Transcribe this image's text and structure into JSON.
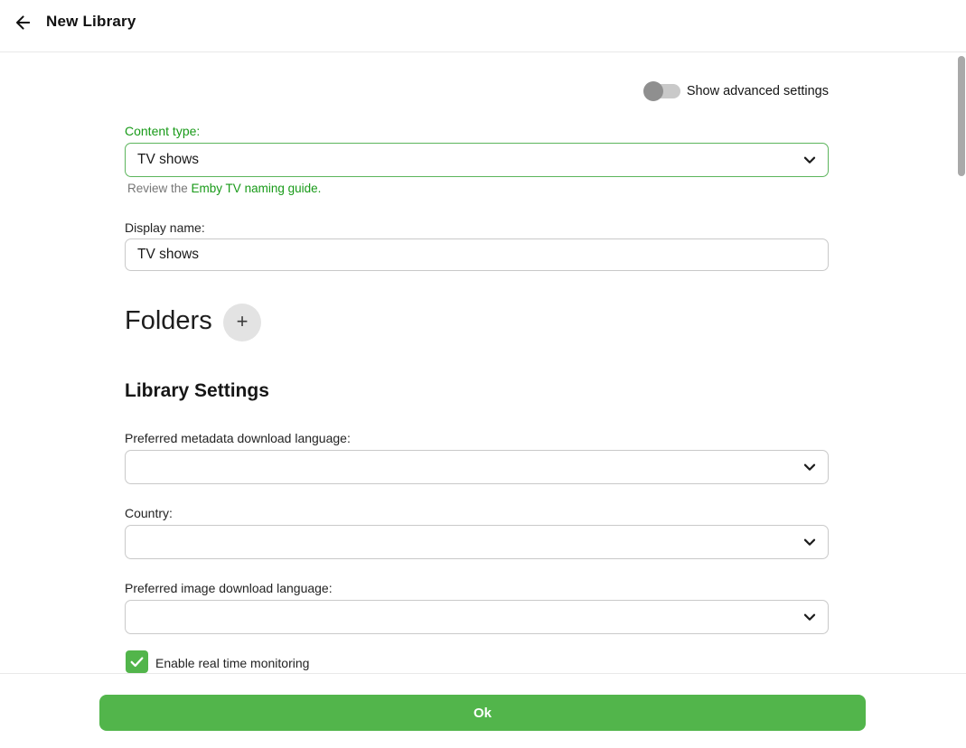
{
  "header": {
    "title": "New Library"
  },
  "advanced_toggle": {
    "label": "Show advanced settings",
    "state": "off"
  },
  "form": {
    "content_type": {
      "label": "Content type:",
      "value": "TV shows",
      "helper_prefix": "Review the ",
      "helper_link": "Emby TV naming guide",
      "helper_suffix": "."
    },
    "display_name": {
      "label": "Display name:",
      "value": "TV shows"
    },
    "folders": {
      "heading": "Folders",
      "add_button": "+"
    },
    "library_settings": {
      "heading": "Library Settings",
      "metadata_language": {
        "label": "Preferred metadata download language:",
        "value": ""
      },
      "country": {
        "label": "Country:",
        "value": ""
      },
      "image_language": {
        "label": "Preferred image download language:",
        "value": ""
      },
      "realtime_monitoring": {
        "label": "Enable real time monitoring",
        "checked": true
      }
    }
  },
  "footer": {
    "ok_label": "Ok"
  },
  "colors": {
    "accent_green": "#52b54b",
    "text_green": "#189a18",
    "select_border_green": "#5cb55c"
  }
}
